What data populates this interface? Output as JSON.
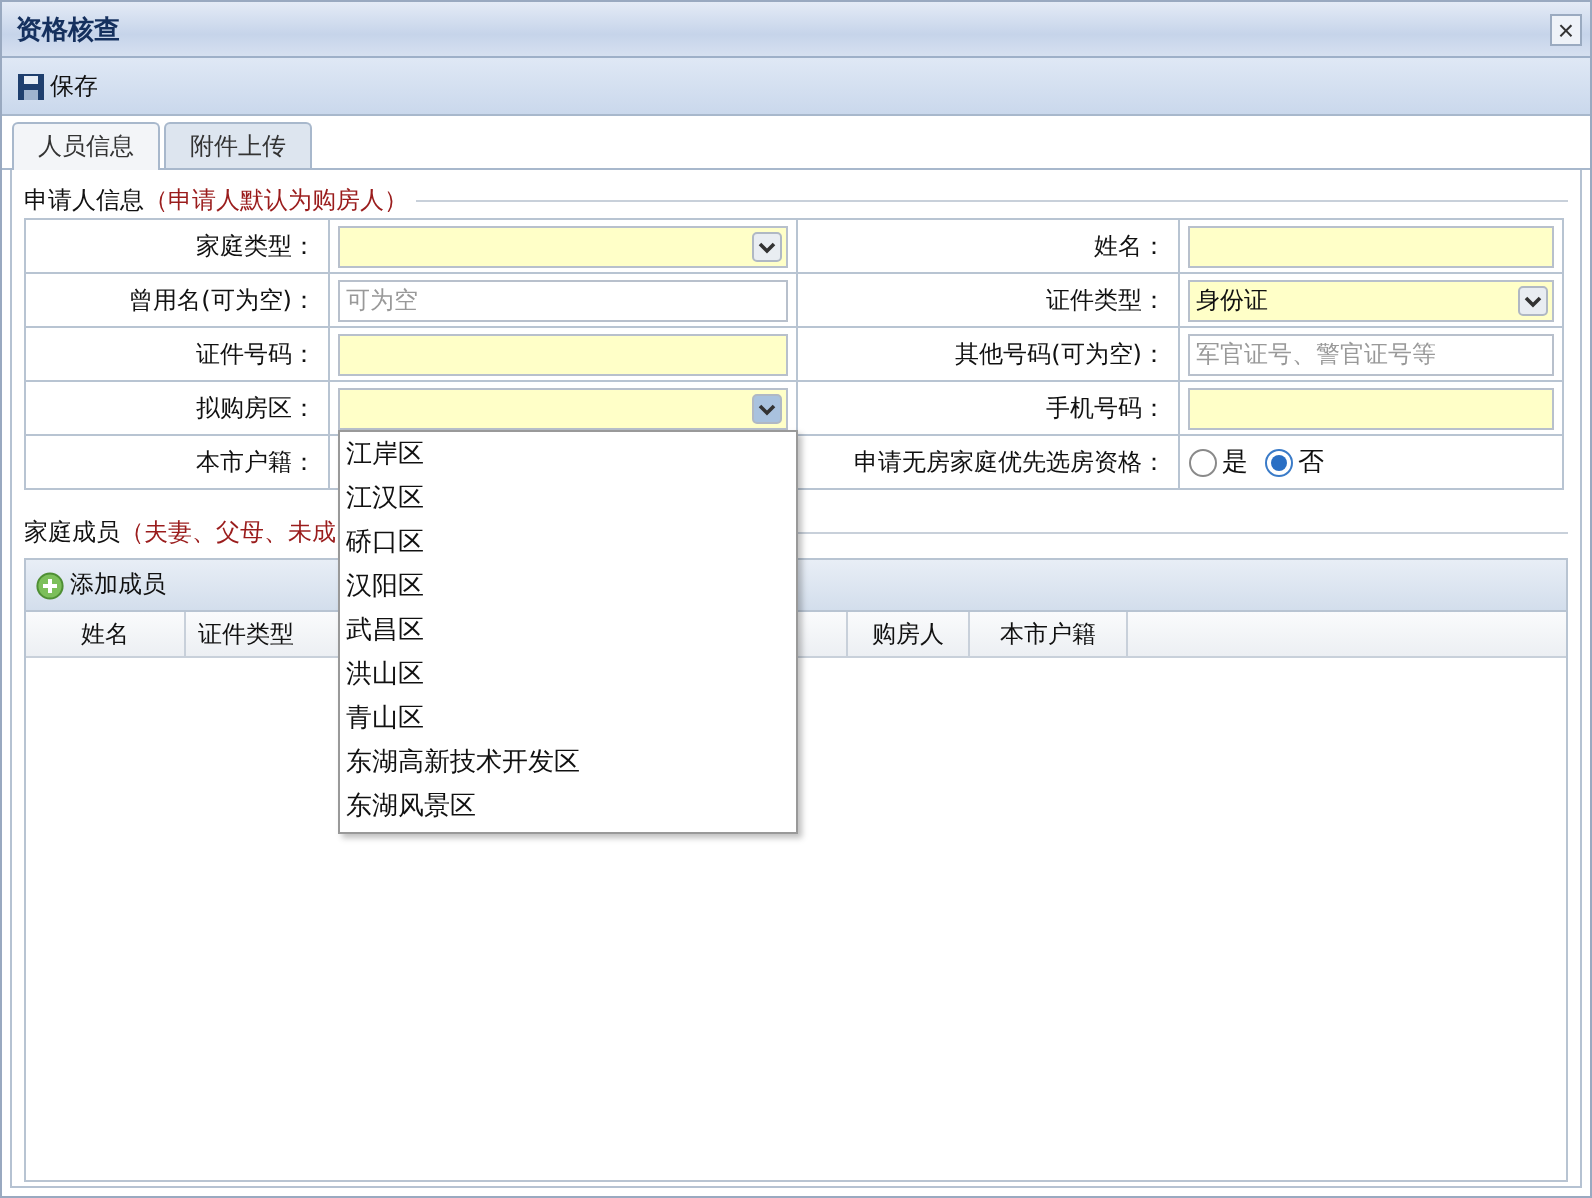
{
  "window": {
    "title": "资格核查",
    "close": "×"
  },
  "toolbar": {
    "save": "保存"
  },
  "tabs": [
    {
      "label": "人员信息",
      "selected": true
    },
    {
      "label": "附件上传",
      "selected": false
    }
  ],
  "applicant": {
    "legend": "申请人信息",
    "note": "（申请人默认为购房人）",
    "rows": [
      {
        "left": {
          "label": "家庭类型：",
          "kind": "select",
          "highlighted": true
        },
        "right": {
          "label": "姓名：",
          "kind": "text",
          "highlighted": true
        }
      },
      {
        "left": {
          "label": "曾用名(可为空)：",
          "kind": "text",
          "placeholder": "可为空",
          "highlighted": false
        },
        "right": {
          "label": "证件类型：",
          "kind": "select",
          "value": "身份证",
          "highlighted": true
        }
      },
      {
        "left": {
          "label": "证件号码：",
          "kind": "text",
          "highlighted": true
        },
        "right": {
          "label": "其他号码(可为空)：",
          "kind": "text",
          "placeholder": "军官证号、警官证号等",
          "highlighted": false
        }
      },
      {
        "left": {
          "label": "拟购房区：",
          "kind": "select",
          "highlighted": true,
          "open": true,
          "options": [
            "江岸区",
            "江汉区",
            "硚口区",
            "汉阳区",
            "武昌区",
            "洪山区",
            "青山区",
            "东湖高新技术开发区",
            "东湖风景区"
          ]
        },
        "right": {
          "label": "手机号码：",
          "kind": "text",
          "highlighted": true
        }
      },
      {
        "left": {
          "label": "本市户籍：",
          "kind": "hidden"
        },
        "right": {
          "label": "申请无房家庭优先选房资格：",
          "kind": "radio",
          "options": [
            {
              "label": "是",
              "selected": false
            },
            {
              "label": "否",
              "selected": true
            }
          ]
        }
      }
    ]
  },
  "members": {
    "legend": "家庭成员",
    "note": "（夫妻、父母、未成",
    "add": "添加成员",
    "columns": [
      "姓名",
      "证件类型",
      "购房人",
      "本市户籍"
    ]
  }
}
